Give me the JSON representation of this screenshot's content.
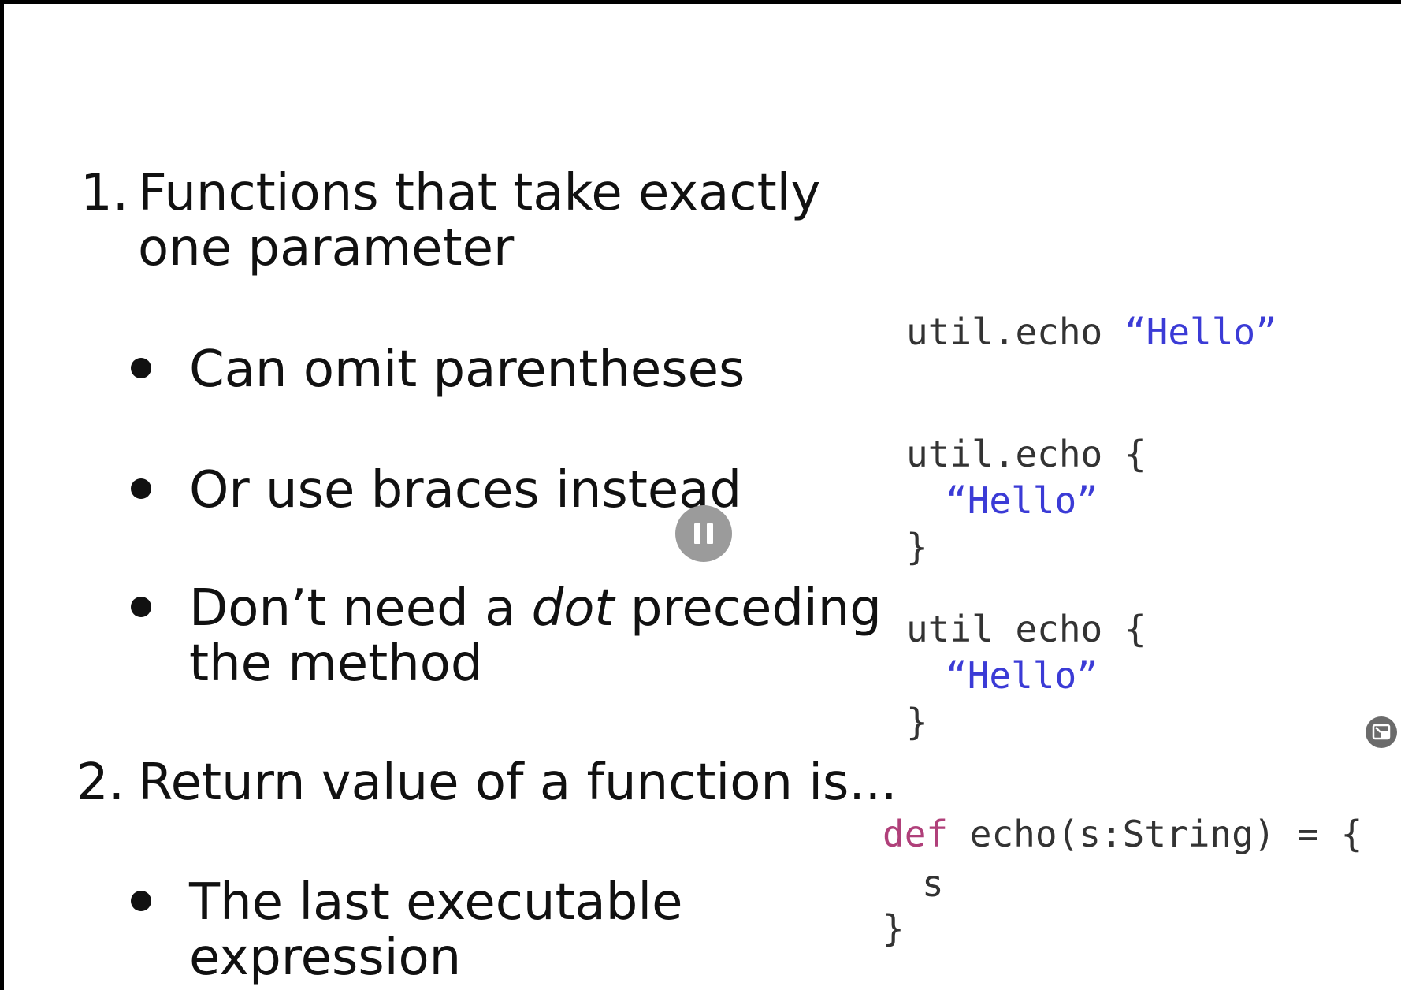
{
  "slide": {
    "item1": {
      "number": "1.",
      "line1": "Functions that take exactly",
      "line2": "one parameter",
      "bullets": [
        {
          "text": "Can omit parentheses"
        },
        {
          "text": "Or use braces instead"
        },
        {
          "pre": "Don’t need a ",
          "em": "dot",
          "post": " preceding",
          "line2": "the method"
        }
      ]
    },
    "item2": {
      "number": "2.",
      "line1": "Return value of a function is...",
      "bullets": [
        {
          "line1": "The last executable",
          "line2": "expression"
        }
      ]
    },
    "code": {
      "ex1": {
        "call": "util.echo ",
        "arg": "“Hello”"
      },
      "ex2": {
        "line1": "util.echo {",
        "arg": "“Hello”",
        "close": "}"
      },
      "ex3": {
        "line1": "util echo {",
        "arg": "“Hello”",
        "close": "}"
      },
      "ex4": {
        "kw": "def",
        "sig": " echo(s:String) = {",
        "body": "s",
        "close": "}"
      }
    },
    "colors": {
      "string": "#3b3bd6",
      "keyword": "#b0407a",
      "text": "#111111"
    }
  },
  "player": {
    "pause_icon": "pause-icon",
    "pip_icon": "picture-in-picture-icon"
  }
}
